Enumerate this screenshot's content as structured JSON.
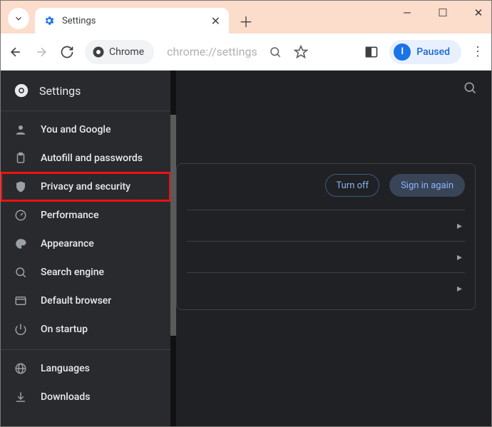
{
  "browser": {
    "tab_title": "Settings",
    "paused_label": "Paused",
    "paused_initial": "I",
    "omnibox_chip": "Chrome",
    "url": "chrome://settings"
  },
  "sidebar": {
    "title": "Settings",
    "items": [
      {
        "label": "You and Google"
      },
      {
        "label": "Autofill and passwords"
      },
      {
        "label": "Privacy and security"
      },
      {
        "label": "Performance"
      },
      {
        "label": "Appearance"
      },
      {
        "label": "Search engine"
      },
      {
        "label": "Default browser"
      },
      {
        "label": "On startup"
      }
    ],
    "more": [
      {
        "label": "Languages"
      },
      {
        "label": "Downloads"
      }
    ]
  },
  "main": {
    "turn_off": "Turn off",
    "sign_in_again": "Sign in again"
  }
}
